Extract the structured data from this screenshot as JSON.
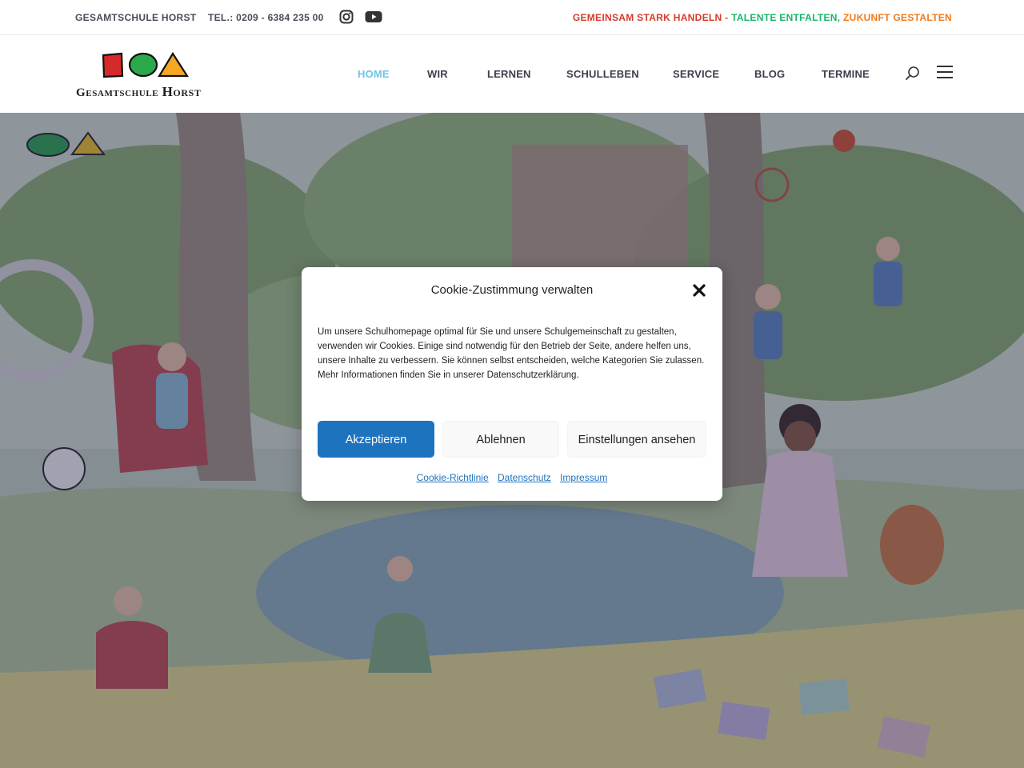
{
  "topbar": {
    "school_name": "GESAMTSCHULE HORST",
    "phone": "TEL.: 0209 - 6384 235 00",
    "slogan_part1": "GEMEINSAM STARK HANDELN",
    "slogan_sep1": " - ",
    "slogan_part2": "TALENTE ENTFALTEN,",
    "slogan_sep2": " ",
    "slogan_part3": "ZUKUNFT GESTALTEN",
    "icons": [
      "instagram-icon",
      "youtube-icon"
    ]
  },
  "header": {
    "logo_text_small": "Gesamtschule",
    "logo_text_big": "Horst",
    "nav": [
      {
        "label": "HOME",
        "active": true
      },
      {
        "label": "WIR",
        "active": false
      },
      {
        "label": "LERNEN",
        "active": false
      },
      {
        "label": "SCHULLEBEN",
        "active": false
      },
      {
        "label": "SERVICE",
        "active": false
      },
      {
        "label": "BLOG",
        "active": false
      },
      {
        "label": "TERMINE",
        "active": false
      }
    ],
    "icons": [
      "search-icon",
      "menu-icon"
    ]
  },
  "cookie": {
    "title": "Cookie-Zustimmung verwalten",
    "text": "Um unsere Schulhomepage optimal für Sie und unsere Schulgemeinschaft zu gestalten, verwenden wir Cookies. Einige sind notwendig für den Betrieb der Seite, andere helfen uns, unsere Inhalte zu verbessern. Sie können selbst entscheiden, welche Kategorien Sie zulassen. Mehr Informationen finden Sie in unserer Datenschutzerklärung.",
    "accept": "Akzeptieren",
    "deny": "Ablehnen",
    "view_settings": "Einstellungen ansehen",
    "links": [
      "Cookie-Richtlinie",
      "Datenschutz",
      "Impressum"
    ]
  },
  "colors": {
    "accent_blue": "#1e73be",
    "nav_active": "#6cc6e4",
    "slogan_red": "#d63a2a",
    "slogan_green": "#19b56b",
    "slogan_orange": "#f07a1a"
  }
}
